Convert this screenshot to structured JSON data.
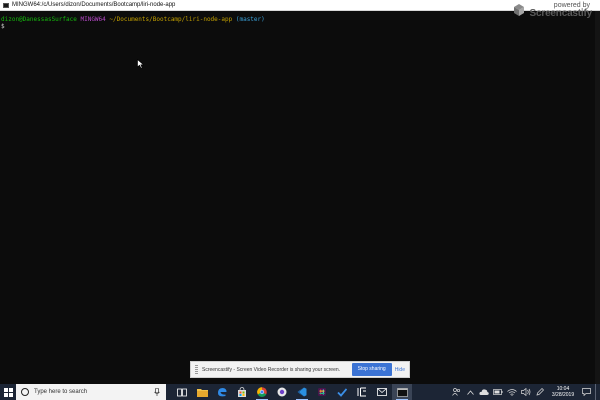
{
  "window": {
    "title": "MINGW64:/c/Users/dizon/Documents/Bootcamp/liri-node-app"
  },
  "terminal": {
    "prompt": {
      "user_host": "dizon@DanessasSurface",
      "system": "MINGW64",
      "path": "~/Documents/Bootcamp/liri-node-app",
      "branch": "(master)"
    },
    "input_line": "$"
  },
  "watermark": {
    "powered": "powered by",
    "brand": "Screencastify"
  },
  "sharing_bar": {
    "message": "Screencastify - Screen Video Recorder is sharing your screen.",
    "stop_label": "Stop sharing",
    "hide_label": "Hide"
  },
  "taskbar": {
    "search_placeholder": "Type here to search",
    "apps": [
      {
        "name": "task-view",
        "icon": "task-view-icon"
      },
      {
        "name": "file-explorer",
        "icon": "folder-icon"
      },
      {
        "name": "edge",
        "icon": "edge-icon"
      },
      {
        "name": "store",
        "icon": "store-icon"
      },
      {
        "name": "chrome",
        "icon": "chrome-icon"
      },
      {
        "name": "github-desktop",
        "icon": "github-icon"
      },
      {
        "name": "vscode",
        "icon": "vscode-icon"
      },
      {
        "name": "slack",
        "icon": "slack-icon"
      },
      {
        "name": "todo",
        "icon": "checkmark-icon"
      },
      {
        "name": "framer",
        "icon": "frame-icon"
      },
      {
        "name": "mail",
        "icon": "mail-icon"
      },
      {
        "name": "git-bash",
        "icon": "terminal-icon"
      }
    ],
    "clock": {
      "time": "10:04",
      "date": "3/28/2019"
    },
    "tray_icons": [
      "people-icon",
      "chevron-up-icon",
      "cloud-icon",
      "battery-icon",
      "wifi-icon",
      "volume-icon",
      "pen-icon",
      "notification-icon"
    ]
  },
  "colors": {
    "terminal_bg": "#0c0c0c",
    "user_green": "#15b70c",
    "system_magenta": "#b548c6",
    "path_yellow": "#c3a000",
    "branch_cyan": "#3aa0d8",
    "taskbar_bg": "#1c2535",
    "stop_button_blue": "#3b73d4"
  }
}
